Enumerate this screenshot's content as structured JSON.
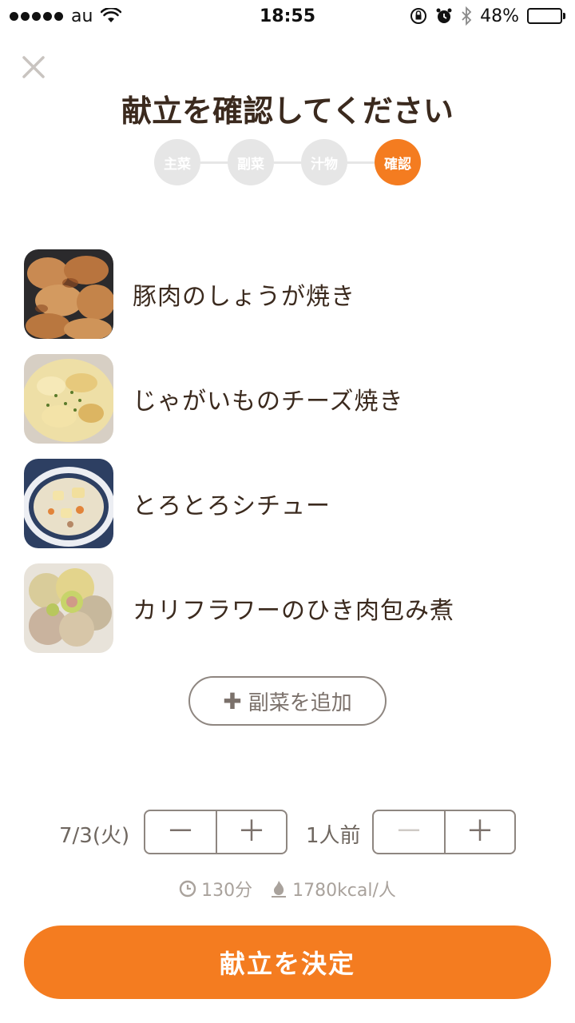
{
  "status_bar": {
    "carrier": "au",
    "time": "18:55",
    "battery_percent_text": "48%",
    "battery_level": 0.48,
    "icons": [
      "signal-dots-icon",
      "wifi-icon",
      "orientation-lock-icon",
      "alarm-icon",
      "bluetooth-icon",
      "battery-icon"
    ]
  },
  "header": {
    "title": "献立を確認してください"
  },
  "steps": [
    {
      "label": "主菜",
      "active": false
    },
    {
      "label": "副菜",
      "active": false
    },
    {
      "label": "汁物",
      "active": false
    },
    {
      "label": "確認",
      "active": true
    }
  ],
  "menu_items": [
    {
      "name": "豚肉のしょうが焼き",
      "thumb": "ginger-pork-thumbnail"
    },
    {
      "name": "じゃがいものチーズ焼き",
      "thumb": "potato-cheese-gratin-thumbnail"
    },
    {
      "name": "とろとろシチュー",
      "thumb": "cream-stew-thumbnail"
    },
    {
      "name": "カリフラワーのひき肉包み煮",
      "thumb": "cauliflower-meatball-thumbnail"
    }
  ],
  "add_button": {
    "icon": "plus-icon",
    "label": "副菜を追加"
  },
  "date": {
    "label": "7/3(火)",
    "minus": "－",
    "plus": "＋"
  },
  "servings": {
    "label": "1人前",
    "minus": "－",
    "plus": "＋",
    "minus_disabled": true
  },
  "info": {
    "time_icon": "clock-icon",
    "time": "130分",
    "calorie_icon": "flame-icon",
    "calories": "1780kcal/人"
  },
  "decide_button": {
    "label": "献立を決定"
  },
  "colors": {
    "accent": "#f47c20",
    "title_text": "#3b2a1e",
    "inactive_step": "#e6e6e6",
    "border": "#8e8680",
    "muted_text": "#a9a29c"
  }
}
